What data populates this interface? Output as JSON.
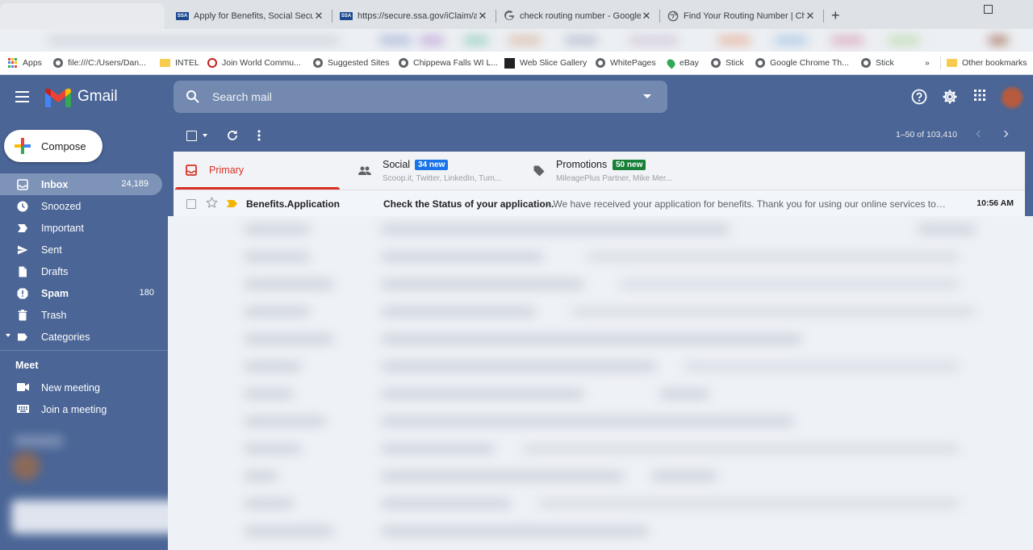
{
  "browser": {
    "tabs": [
      {
        "title": "Apply for Benefits, Social Security",
        "favicon": "ssa-icon"
      },
      {
        "title": "https://secure.ssa.gov/iClaim/ap",
        "favicon": "ssa-icon"
      },
      {
        "title": "check routing number - Google S",
        "favicon": "google-icon"
      },
      {
        "title": "Find Your Routing Number | Che",
        "favicon": "globe-icon"
      }
    ],
    "ssa_favicon_text": "SSA",
    "bookmarks": [
      {
        "label": "Apps",
        "icon": "apps-icon"
      },
      {
        "label": "file:///C:/Users/Dan...",
        "icon": "globe-icon"
      },
      {
        "label": "INTEL",
        "icon": "folder-icon"
      },
      {
        "label": "Join World Commu...",
        "icon": "globe-icon"
      },
      {
        "label": "Suggested Sites",
        "icon": "globe-icon"
      },
      {
        "label": "Chippewa Falls WI L...",
        "icon": "globe-icon"
      },
      {
        "label": "Web Slice Gallery",
        "icon": "web-slice-icon"
      },
      {
        "label": "WhitePages",
        "icon": "globe-icon"
      },
      {
        "label": "eBay",
        "icon": "map-pin-icon"
      },
      {
        "label": "Stick",
        "icon": "globe-icon"
      },
      {
        "label": "Google Chrome Th...",
        "icon": "globe-icon"
      },
      {
        "label": "Stick",
        "icon": "globe-icon"
      }
    ],
    "overflow_label": "»",
    "other_bookmarks": "Other bookmarks"
  },
  "gmail": {
    "logo_text": "Gmail",
    "search_placeholder": "Search mail",
    "compose_label": "Compose",
    "nav": [
      {
        "label": "Inbox",
        "count": "24,189",
        "icon": "inbox-icon"
      },
      {
        "label": "Snoozed",
        "count": "",
        "icon": "clock-icon"
      },
      {
        "label": "Important",
        "count": "",
        "icon": "important-icon"
      },
      {
        "label": "Sent",
        "count": "",
        "icon": "send-icon"
      },
      {
        "label": "Drafts",
        "count": "",
        "icon": "draft-icon"
      },
      {
        "label": "Spam",
        "count": "180",
        "icon": "spam-icon"
      },
      {
        "label": "Trash",
        "count": "",
        "icon": "trash-icon"
      },
      {
        "label": "Categories",
        "count": "",
        "icon": "label-icon"
      }
    ],
    "meet": {
      "title": "Meet",
      "items": [
        {
          "label": "New meeting",
          "icon": "video-icon"
        },
        {
          "label": "Join a meeting",
          "icon": "keyboard-icon"
        }
      ]
    },
    "pager": "1–50 of 103,410",
    "categories": [
      {
        "name": "Primary",
        "badge": "",
        "sub": ""
      },
      {
        "name": "Social",
        "badge": "34 new",
        "sub": "Scoop.it, Twitter, LinkedIn, Tum..."
      },
      {
        "name": "Promotions",
        "badge": "50 new",
        "sub": "MileagePlus Partner, Mike Mer..."
      }
    ],
    "emails": [
      {
        "sender": "Benefits.Application",
        "subject": "Check the Status of your application.",
        "snippet": "- We have received your application for benefits. Thank you for using our online services to apply for benefits.",
        "time": "10:56 AM"
      }
    ],
    "colors": {
      "theme": "#4a6596",
      "primary_tab": "#d93025",
      "social_badge": "#1a73e8",
      "promotions_badge": "#188038"
    }
  }
}
